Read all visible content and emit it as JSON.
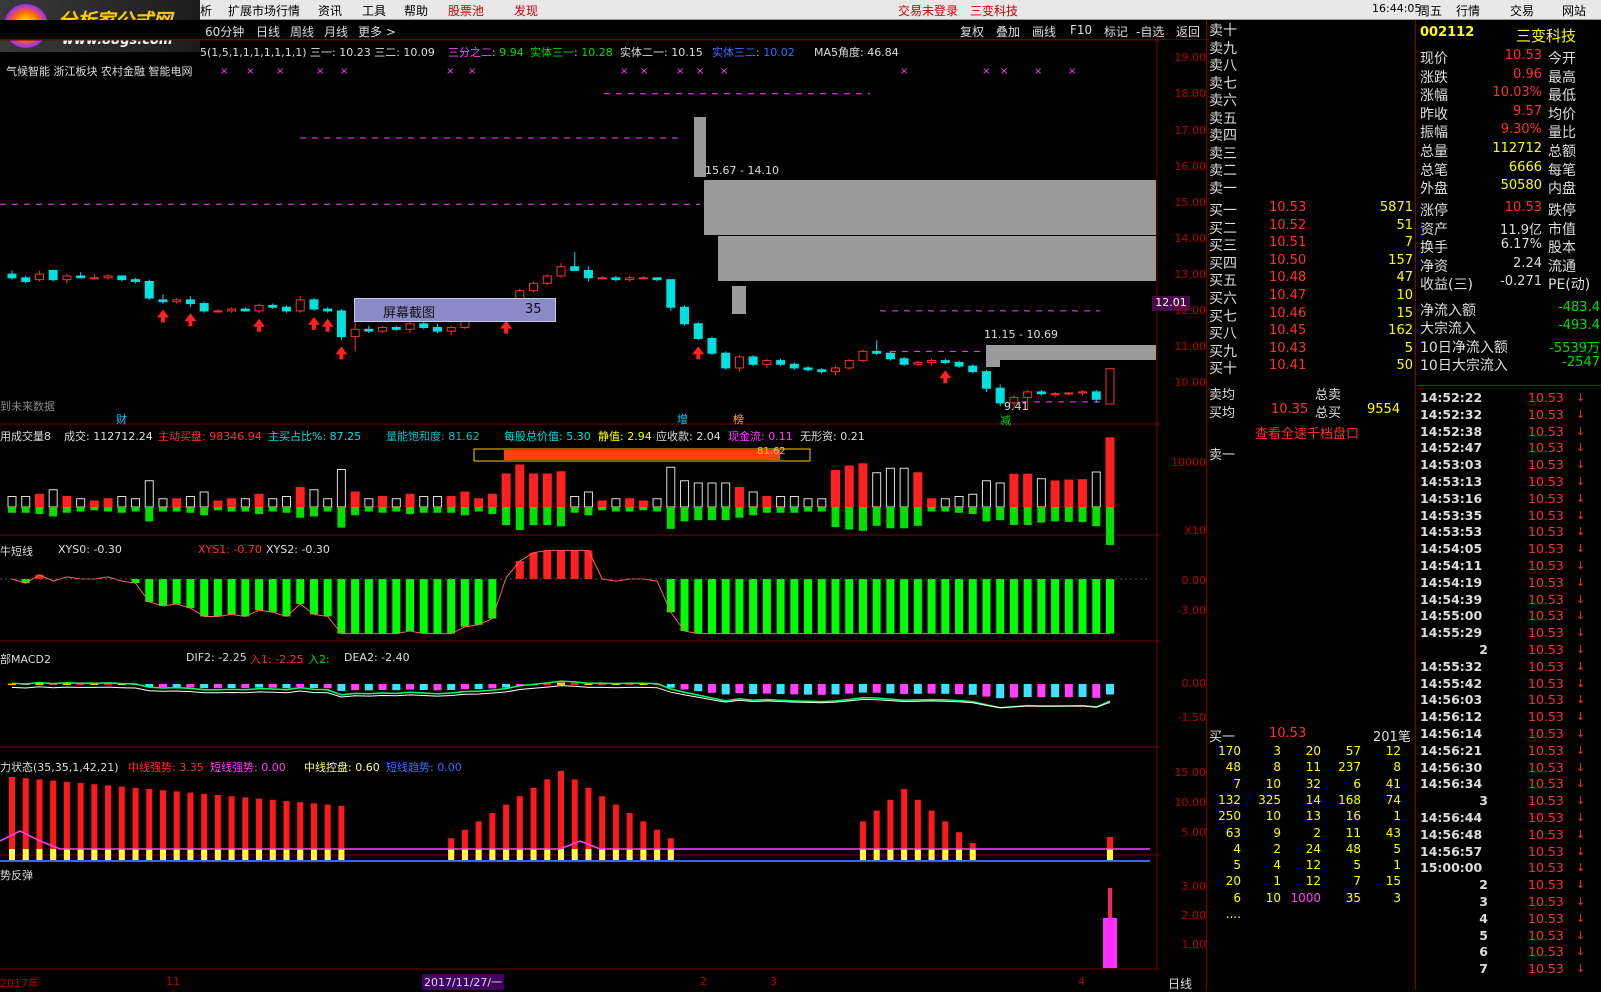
{
  "menu": {
    "items": [
      "析",
      "扩展市场行情",
      "资讯",
      "工具",
      "帮助",
      "股票池",
      "发现"
    ],
    "login": "交易未登录",
    "company": "三变科技",
    "time": "16:44:05",
    "day": "周五",
    "right": [
      "行情",
      "交易",
      "网站"
    ]
  },
  "logo": {
    "title": "分析家公式网",
    "url": "www.88gs.com"
  },
  "toolbar": {
    "periods": [
      "60分钟",
      "日线",
      "周线",
      "月线",
      "更多 >"
    ],
    "actions": [
      "复权",
      "叠加",
      "画线",
      "F10",
      "标记",
      "-自选",
      "返回"
    ]
  },
  "main": {
    "indicator_line": "5(1,5,1,1,1,1,1,1,1)  三一: 10.23  三二: 10.09",
    "ind": [
      {
        "k": "三分之二",
        "v": "9.94"
      },
      {
        "k": "实体三一",
        "v": "10.28"
      },
      {
        "k": "实体二一",
        "v": "10.15"
      },
      {
        "k": "实体三二",
        "v": "10.02"
      }
    ],
    "ma5": "MA5角度: 46.84",
    "concept": "气候智能 浙江板块 农村金融 智能电网",
    "screenshot_btn": "屏幕截图",
    "screenshot_num": "35",
    "zone1": "15.67 - 14.10",
    "zone2": "11.15 - 10.69",
    "low": "9.41",
    "current_tag": "12.01",
    "future_text": "到未来数据",
    "marks": {
      "cai": "财",
      "zeng": "增",
      "bang": "榜",
      "jian": "减"
    },
    "price_axis": [
      "19.00",
      "18.00",
      "17.00",
      "16.00",
      "15.00",
      "14.00",
      "13.00",
      "12.00",
      "11.00",
      "10.00"
    ]
  },
  "vol": {
    "title": "用成交量8",
    "vol": "成交: 112712.24",
    "active": "主动买盘: 98346.94",
    "ratio": "主买占比%: 87.25",
    "sat": "量能饱和度: 81.62",
    "bar_val": "81.62",
    "eps": "每股总价值: 5.30",
    "jing": "静值: 2.94",
    "ysk": "应收款: 2.04",
    "cash": "现金流: 0.11",
    "wx": "无形资: 0.21",
    "axis": [
      "10000",
      "X10"
    ]
  },
  "short": {
    "title": "牛短线",
    "xys0": "XYS0: -0.30",
    "xys1": "XYS1: -0.70",
    "xys2": "XYS2: -0.30",
    "axis": [
      "0.00",
      "-3.00"
    ]
  },
  "macd": {
    "title": "部MACD2",
    "dif": "DIF2: -2.25",
    "in1": "入1: -2.25",
    "in2": "入2:",
    "dea": "DEA2: -2.40",
    "axis": [
      "0.00",
      "-1.50"
    ]
  },
  "power": {
    "title": "力状态(35,35,1,42,21)",
    "a": "中线强势: 3.35",
    "b": "短线强势: 0.00",
    "c": "中线控盘: 0.60",
    "d": "短线趋势: 0.00",
    "axis": [
      "15.00",
      "10.00",
      "5.00"
    ]
  },
  "rebound": {
    "title": "势反弹",
    "axis": [
      "3.00",
      "2.00",
      "1.00"
    ]
  },
  "dates": [
    "2017年",
    "11",
    "2017/11/27/一",
    "2",
    "3",
    "4"
  ],
  "period_label": "日线",
  "orderbook": {
    "sell": [
      "卖十",
      "卖九",
      "卖八",
      "卖七",
      "卖六",
      "卖五",
      "卖四",
      "卖三",
      "卖二",
      "卖一"
    ],
    "buy": [
      [
        "买一",
        "10.53",
        "5871"
      ],
      [
        "买二",
        "10.52",
        "51"
      ],
      [
        "买三",
        "10.51",
        "7"
      ],
      [
        "买四",
        "10.50",
        "157"
      ],
      [
        "买五",
        "10.48",
        "47"
      ],
      [
        "买六",
        "10.47",
        "10"
      ],
      [
        "买七",
        "10.46",
        "15"
      ],
      [
        "买八",
        "10.45",
        "162"
      ],
      [
        "买九",
        "10.43",
        "5"
      ],
      [
        "买十",
        "10.41",
        "50"
      ]
    ],
    "avg_sell": "卖均",
    "total_sell": "总卖",
    "avg_buy": "买均",
    "avg_buy_v": "10.35",
    "total_buy": "总买",
    "total_buy_v": "9554",
    "link": "查看全速千档盘口",
    "sell1": "卖一",
    "buy1_label": "买一",
    "buy1_price": "10.53",
    "buy1_count": "201笔",
    "queue": [
      [
        "170",
        "3",
        "20",
        "57",
        "12"
      ],
      [
        "48",
        "8",
        "11",
        "237",
        "8"
      ],
      [
        "7",
        "10",
        "32",
        "6",
        "41"
      ],
      [
        "132",
        "325",
        "14",
        "168",
        "74"
      ],
      [
        "250",
        "10",
        "13",
        "16",
        "1"
      ],
      [
        "63",
        "9",
        "2",
        "11",
        "43"
      ],
      [
        "4",
        "2",
        "24",
        "48",
        "5"
      ],
      [
        "5",
        "4",
        "12",
        "5",
        "1"
      ],
      [
        "20",
        "1",
        "12",
        "7",
        "15"
      ],
      [
        "6",
        "10",
        "1000",
        "35",
        "3"
      ],
      [
        "....",
        "",
        "",
        "",
        ""
      ]
    ]
  },
  "quote": {
    "code": "002112",
    "name": "三变科技",
    "rows": [
      [
        "现价",
        "10.53",
        "今开",
        ""
      ],
      [
        "涨跌",
        "0.96",
        "最高",
        ""
      ],
      [
        "涨幅",
        "10.03%",
        "最低",
        ""
      ],
      [
        "昨收",
        "9.57",
        "均价",
        ""
      ],
      [
        "振幅",
        "9.30%",
        "量比",
        ""
      ],
      [
        "总量",
        "112712",
        "总额",
        ""
      ],
      [
        "总笔",
        "6666",
        "每笔",
        ""
      ],
      [
        "外盘",
        "50580",
        "内盘",
        ""
      ]
    ],
    "rows2": [
      [
        "涨停",
        "10.53",
        "跌停",
        ""
      ],
      [
        "资产",
        "11.9亿",
        "市值",
        ""
      ],
      [
        "换手",
        "6.17%",
        "股本",
        ""
      ],
      [
        "净资",
        "2.24",
        "流通",
        ""
      ],
      [
        "收益(三)",
        "-0.271",
        "PE(动)",
        ""
      ]
    ],
    "flows": [
      [
        "净流入额",
        "-483.4"
      ],
      [
        "大宗流入",
        "-493.4"
      ],
      [
        "10日净流入额",
        "-5539万"
      ],
      [
        "10日大宗流入",
        "-2547"
      ]
    ]
  },
  "ticks": [
    [
      "14:52:22",
      "10.53"
    ],
    [
      "14:52:32",
      "10.53"
    ],
    [
      "14:52:38",
      "10.53"
    ],
    [
      "14:52:47",
      "10.53"
    ],
    [
      "14:53:03",
      "10.53"
    ],
    [
      "14:53:13",
      "10.53"
    ],
    [
      "14:53:16",
      "10.53"
    ],
    [
      "14:53:35",
      "10.53"
    ],
    [
      "14:53:53",
      "10.53"
    ],
    [
      "14:54:05",
      "10.53"
    ],
    [
      "14:54:11",
      "10.53"
    ],
    [
      "14:54:19",
      "10.53"
    ],
    [
      "14:54:39",
      "10.53"
    ],
    [
      "14:55:00",
      "10.53"
    ],
    [
      "14:55:29",
      "10.53"
    ],
    [
      "2",
      "10.53"
    ],
    [
      "14:55:32",
      "10.53"
    ],
    [
      "14:55:42",
      "10.53"
    ],
    [
      "14:56:03",
      "10.53"
    ],
    [
      "14:56:12",
      "10.53"
    ],
    [
      "14:56:14",
      "10.53"
    ],
    [
      "14:56:21",
      "10.53"
    ],
    [
      "14:56:30",
      "10.53"
    ],
    [
      "14:56:34",
      "10.53"
    ],
    [
      "3",
      "10.53"
    ],
    [
      "14:56:44",
      "10.53"
    ],
    [
      "14:56:48",
      "10.53"
    ],
    [
      "14:56:57",
      "10.53"
    ],
    [
      "15:00:00",
      "10.53"
    ],
    [
      "2",
      "10.53"
    ],
    [
      "3",
      "10.53"
    ],
    [
      "4",
      "10.53"
    ],
    [
      "5",
      "10.53"
    ],
    [
      "6",
      "10.53"
    ],
    [
      "7",
      "10.53"
    ]
  ],
  "candles": [
    [
      13.1,
      13.2,
      12.95,
      13.0
    ],
    [
      13.0,
      13.05,
      12.85,
      12.9
    ],
    [
      12.95,
      13.2,
      12.9,
      13.1
    ],
    [
      13.2,
      13.2,
      12.9,
      12.95
    ],
    [
      12.95,
      13.1,
      12.85,
      13.05
    ],
    [
      13.05,
      13.15,
      13.0,
      13.0
    ],
    [
      13.0,
      13.1,
      12.95,
      13.0
    ],
    [
      13.0,
      13.1,
      12.95,
      13.05
    ],
    [
      13.05,
      13.05,
      12.9,
      12.95
    ],
    [
      12.95,
      13.0,
      12.85,
      12.9
    ],
    [
      12.9,
      12.95,
      12.4,
      12.45
    ],
    [
      12.4,
      12.55,
      12.3,
      12.35
    ],
    [
      12.35,
      12.45,
      12.3,
      12.4
    ],
    [
      12.4,
      12.5,
      12.2,
      12.3
    ],
    [
      12.3,
      12.35,
      12.05,
      12.1
    ],
    [
      12.1,
      12.15,
      12.05,
      12.1
    ],
    [
      12.1,
      12.2,
      12.05,
      12.15
    ],
    [
      12.15,
      12.2,
      12.1,
      12.1
    ],
    [
      12.1,
      12.3,
      12.05,
      12.25
    ],
    [
      12.25,
      12.3,
      12.15,
      12.2
    ],
    [
      12.2,
      12.25,
      12.05,
      12.1
    ],
    [
      12.1,
      12.5,
      12.05,
      12.4
    ],
    [
      12.4,
      12.45,
      12.1,
      12.15
    ],
    [
      12.15,
      12.2,
      12.05,
      12.1
    ],
    [
      12.1,
      12.15,
      11.3,
      11.4
    ],
    [
      11.4,
      11.8,
      11.0,
      11.6
    ],
    [
      11.6,
      11.7,
      11.5,
      11.55
    ],
    [
      11.55,
      11.7,
      11.5,
      11.65
    ],
    [
      11.65,
      11.7,
      11.55,
      11.6
    ],
    [
      11.6,
      11.8,
      11.5,
      11.75
    ],
    [
      11.75,
      11.8,
      11.6,
      11.65
    ],
    [
      11.65,
      11.75,
      11.5,
      11.55
    ],
    [
      11.55,
      11.7,
      11.45,
      11.65
    ],
    [
      11.65,
      11.9,
      11.6,
      11.85
    ],
    [
      11.85,
      12.0,
      11.8,
      11.9
    ],
    [
      11.9,
      12.1,
      11.85,
      12.05
    ],
    [
      12.05,
      12.3,
      12.0,
      12.25
    ],
    [
      12.25,
      12.7,
      12.2,
      12.65
    ],
    [
      12.65,
      12.9,
      12.6,
      12.85
    ],
    [
      12.85,
      13.1,
      12.8,
      13.05
    ],
    [
      13.05,
      13.4,
      13.0,
      13.3
    ],
    [
      13.3,
      13.7,
      13.2,
      13.2
    ],
    [
      13.2,
      13.3,
      12.9,
      13.0
    ],
    [
      13.0,
      13.05,
      12.95,
      13.0
    ],
    [
      13.0,
      13.05,
      12.9,
      12.95
    ],
    [
      12.95,
      13.05,
      12.9,
      13.0
    ],
    [
      13.0,
      13.05,
      12.95,
      13.0
    ],
    [
      13.0,
      13.0,
      12.9,
      12.95
    ],
    [
      12.95,
      12.95,
      12.1,
      12.2
    ],
    [
      12.2,
      12.25,
      11.7,
      11.75
    ],
    [
      11.75,
      11.8,
      11.3,
      11.35
    ],
    [
      11.35,
      11.4,
      10.9,
      10.95
    ],
    [
      10.95,
      11.0,
      10.5,
      10.55
    ],
    [
      10.55,
      10.9,
      10.45,
      10.85
    ],
    [
      10.85,
      10.9,
      10.6,
      10.65
    ],
    [
      10.65,
      10.8,
      10.55,
      10.75
    ],
    [
      10.75,
      10.8,
      10.6,
      10.65
    ],
    [
      10.65,
      10.7,
      10.5,
      10.55
    ],
    [
      10.55,
      10.6,
      10.45,
      10.5
    ],
    [
      10.5,
      10.55,
      10.4,
      10.45
    ],
    [
      10.45,
      10.6,
      10.35,
      10.55
    ],
    [
      10.55,
      10.8,
      10.5,
      10.75
    ],
    [
      10.75,
      11.05,
      10.7,
      11.0
    ],
    [
      11.0,
      11.3,
      10.9,
      10.95
    ],
    [
      10.95,
      11.0,
      10.75,
      10.8
    ],
    [
      10.8,
      10.85,
      10.6,
      10.65
    ],
    [
      10.65,
      10.75,
      10.6,
      10.7
    ],
    [
      10.7,
      10.8,
      10.6,
      10.75
    ],
    [
      10.75,
      10.8,
      10.65,
      10.7
    ],
    [
      10.7,
      10.75,
      10.55,
      10.6
    ],
    [
      10.6,
      10.65,
      10.4,
      10.45
    ],
    [
      10.45,
      10.5,
      9.9,
      10.0
    ],
    [
      10.0,
      10.1,
      9.5,
      9.6
    ],
    [
      9.6,
      9.8,
      9.45,
      9.75
    ],
    [
      9.75,
      9.95,
      9.41,
      9.9
    ],
    [
      9.9,
      9.95,
      9.8,
      9.85
    ],
    [
      9.85,
      9.9,
      9.75,
      9.85
    ],
    [
      9.85,
      9.9,
      9.8,
      9.87
    ],
    [
      9.87,
      9.95,
      9.8,
      9.9
    ],
    [
      9.9,
      9.95,
      9.6,
      9.7
    ],
    [
      9.57,
      10.53,
      9.57,
      10.53
    ]
  ]
}
